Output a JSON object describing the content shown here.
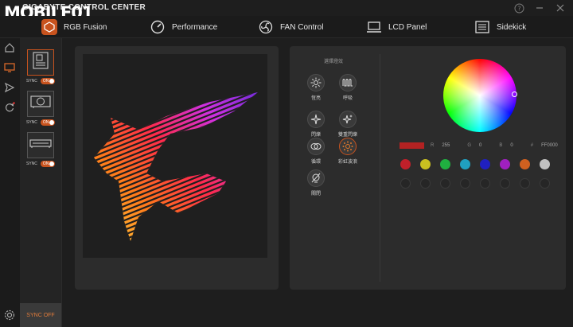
{
  "app": {
    "title": "GIGABYTE CONTROL CENTER",
    "watermark": "MOBILE01"
  },
  "tabs": [
    {
      "label": "RGB Fusion",
      "icon": "rgb-fusion-icon"
    },
    {
      "label": "Performance",
      "icon": "speedometer-icon"
    },
    {
      "label": "FAN Control",
      "icon": "fan-icon"
    },
    {
      "label": "LCD Panel",
      "icon": "laptop-icon"
    },
    {
      "label": "Sidekick",
      "icon": "list-window-icon"
    }
  ],
  "rail": [
    "home-icon",
    "monitor-icon",
    "send-icon",
    "refresh-icon",
    "gear-icon"
  ],
  "devices": [
    {
      "icon": "motherboard-icon",
      "sync": "SYNC",
      "toggle": "ON"
    },
    {
      "icon": "graphics-card-icon",
      "sync": "SYNC",
      "toggle": "ON"
    },
    {
      "icon": "memory-module-icon",
      "sync": "SYNC",
      "toggle": "ON"
    }
  ],
  "sync_off": "SYNC OFF",
  "effects": {
    "title": "選擇燈效",
    "items": [
      {
        "label": "恆亮",
        "icon": "sun-icon"
      },
      {
        "label": "呼吸",
        "icon": "wave-icon"
      },
      {
        "label": "閃爍",
        "icon": "sparkle-icon"
      },
      {
        "label": "雙重閃爍",
        "icon": "double-sparkle-icon"
      },
      {
        "label": "循環",
        "icon": "cycle-icon"
      },
      {
        "label": "彩虹波浪",
        "icon": "rainbow-wave-icon"
      },
      {
        "label": "關閉",
        "icon": "off-icon"
      }
    ]
  },
  "color": {
    "swatch": "#b22222",
    "r_label": "R",
    "r": "255",
    "g_label": "G",
    "g": "0",
    "b_label": "B",
    "b": "0",
    "hex_label": "#",
    "hex": "FF0000"
  },
  "presets": [
    "#c0202a",
    "#c8c020",
    "#20b040",
    "#20a0c0",
    "#2020c0",
    "#a020c0",
    "#d06020",
    "#c0c0c0"
  ],
  "accent": "#c8531e"
}
